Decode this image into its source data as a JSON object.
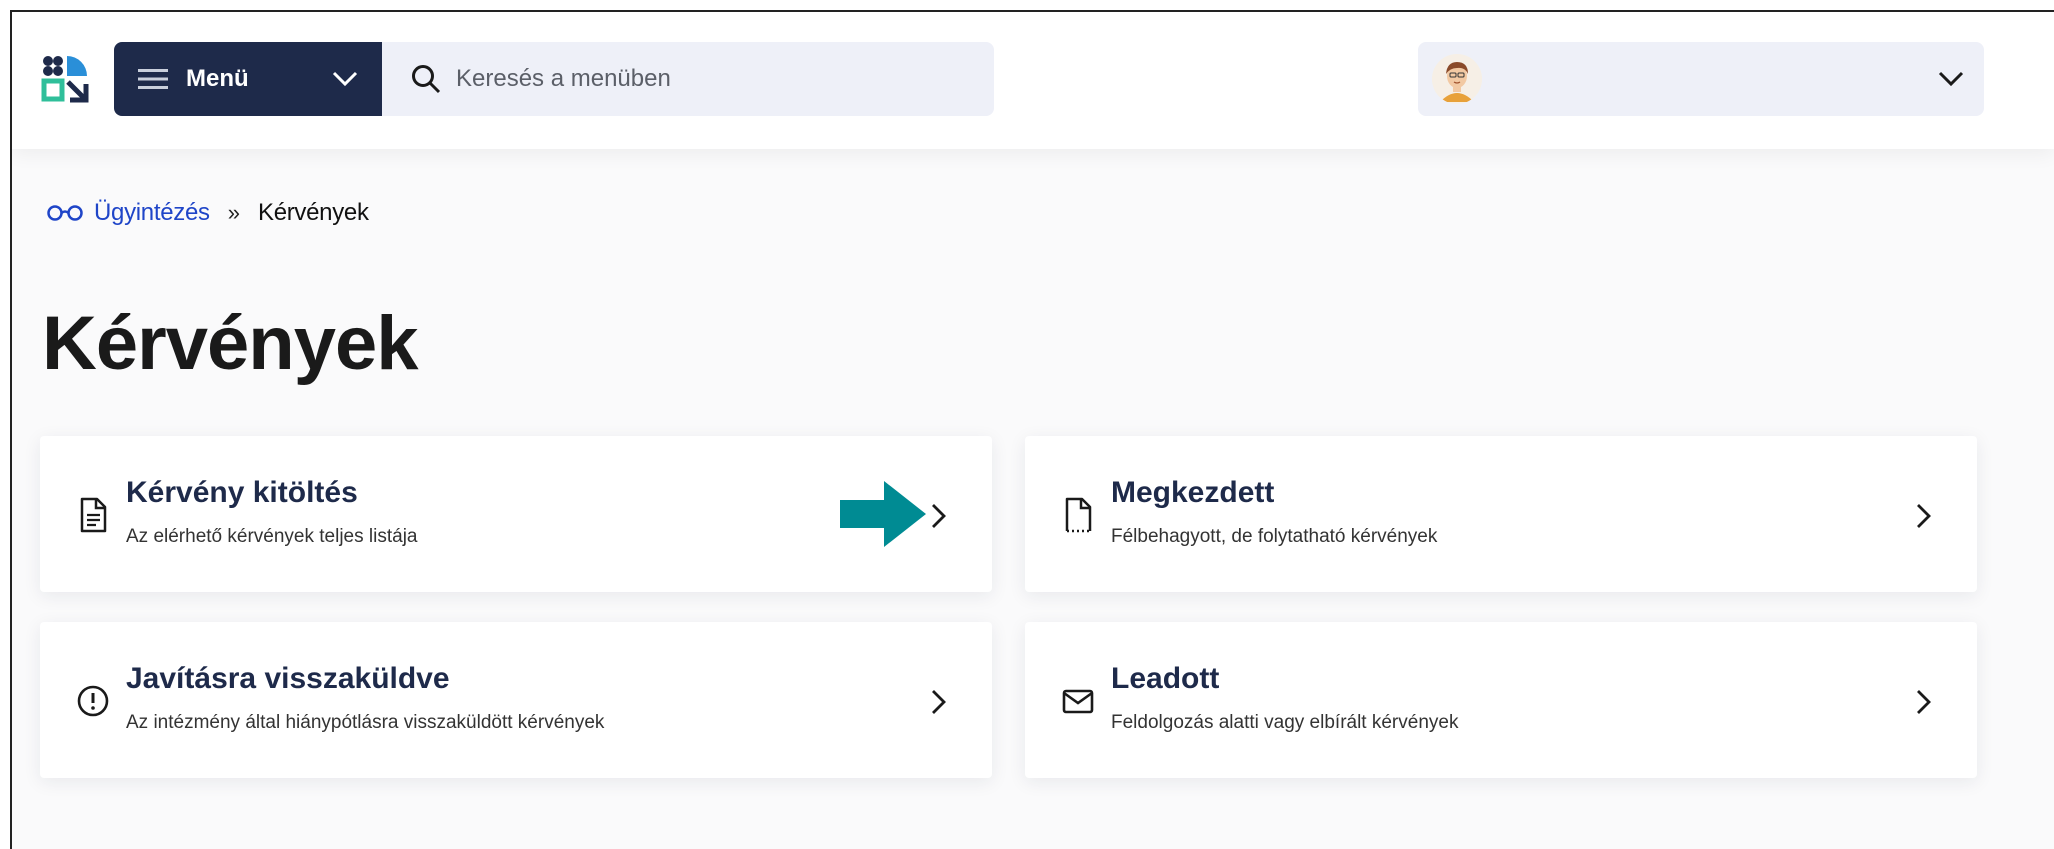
{
  "header": {
    "menu_label": "Menü",
    "search_placeholder": "Keresés a menüben"
  },
  "breadcrumb": {
    "parent": "Ügyintézés",
    "separator": "»",
    "current": "Kérvények"
  },
  "page": {
    "title": "Kérvények"
  },
  "cards": [
    {
      "title": "Kérvény kitöltés",
      "subtitle": "Az elérhető kérvények teljes listája",
      "icon": "document-icon"
    },
    {
      "title": "Megkezdett",
      "subtitle": "Félbehagyott, de folytatható kérvények",
      "icon": "draft-document-icon"
    },
    {
      "title": "Javításra visszaküldve",
      "subtitle": "Az intézmény által hiánypótlásra visszaküldött kérvények",
      "icon": "alert-icon"
    },
    {
      "title": "Leadott",
      "subtitle": "Feldolgozás alatti vagy elbírált kérvények",
      "icon": "mail-icon"
    }
  ],
  "colors": {
    "navy": "#1e2a4a",
    "link_blue": "#1f45c8",
    "teal_arrow": "#008b93",
    "input_bg": "#eef0f8"
  }
}
